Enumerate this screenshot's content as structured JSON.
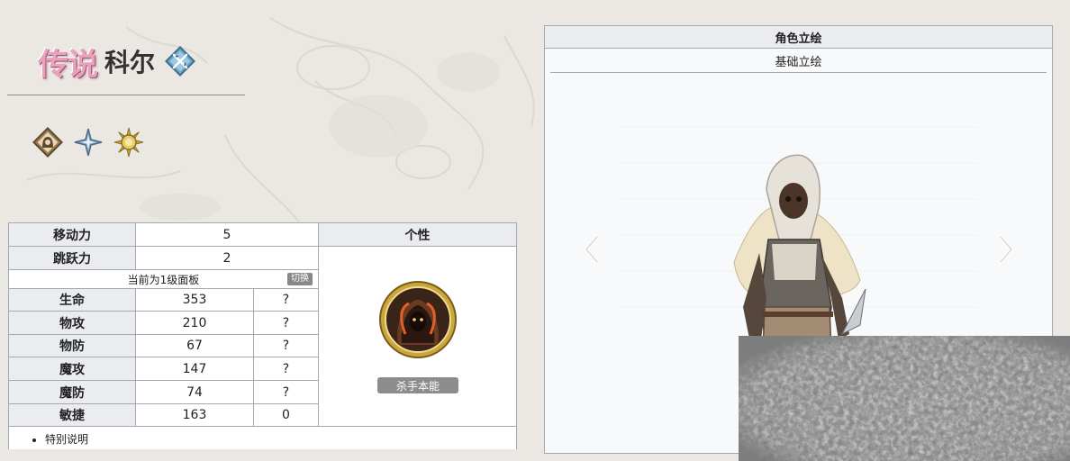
{
  "header": {
    "rarity": "传说",
    "name": "科尔",
    "class_icon": "crossed-blades-icon",
    "trait_icons": [
      "hooded-figure-icon",
      "four-point-star-icon",
      "sun-emblem-icon"
    ]
  },
  "stats": {
    "rows_top": [
      {
        "label": "移动力",
        "value": "5"
      },
      {
        "label": "跳跃力",
        "value": "2"
      }
    ],
    "panel_status": "当前为1级面板",
    "switch_label": "切换",
    "rows": [
      {
        "label": "生命",
        "value": "353",
        "extra": "?"
      },
      {
        "label": "物攻",
        "value": "210",
        "extra": "?"
      },
      {
        "label": "物防",
        "value": "67",
        "extra": "?"
      },
      {
        "label": "魔攻",
        "value": "147",
        "extra": "?"
      },
      {
        "label": "魔防",
        "value": "74",
        "extra": "?"
      },
      {
        "label": "敏捷",
        "value": "163",
        "extra": "0"
      }
    ],
    "trait_title": "个性",
    "skill_icon": "assassin-hood-emblem-icon",
    "skill_name": "杀手本能",
    "notes": "特别说明"
  },
  "portrait": {
    "title": "角色立绘",
    "tab": "基础立绘"
  },
  "colors": {
    "header_bg": "#eaecf0",
    "border": "#a2a9b1",
    "rarity_pink": "#e8a3bb",
    "skill_gold": "#c9a640"
  }
}
